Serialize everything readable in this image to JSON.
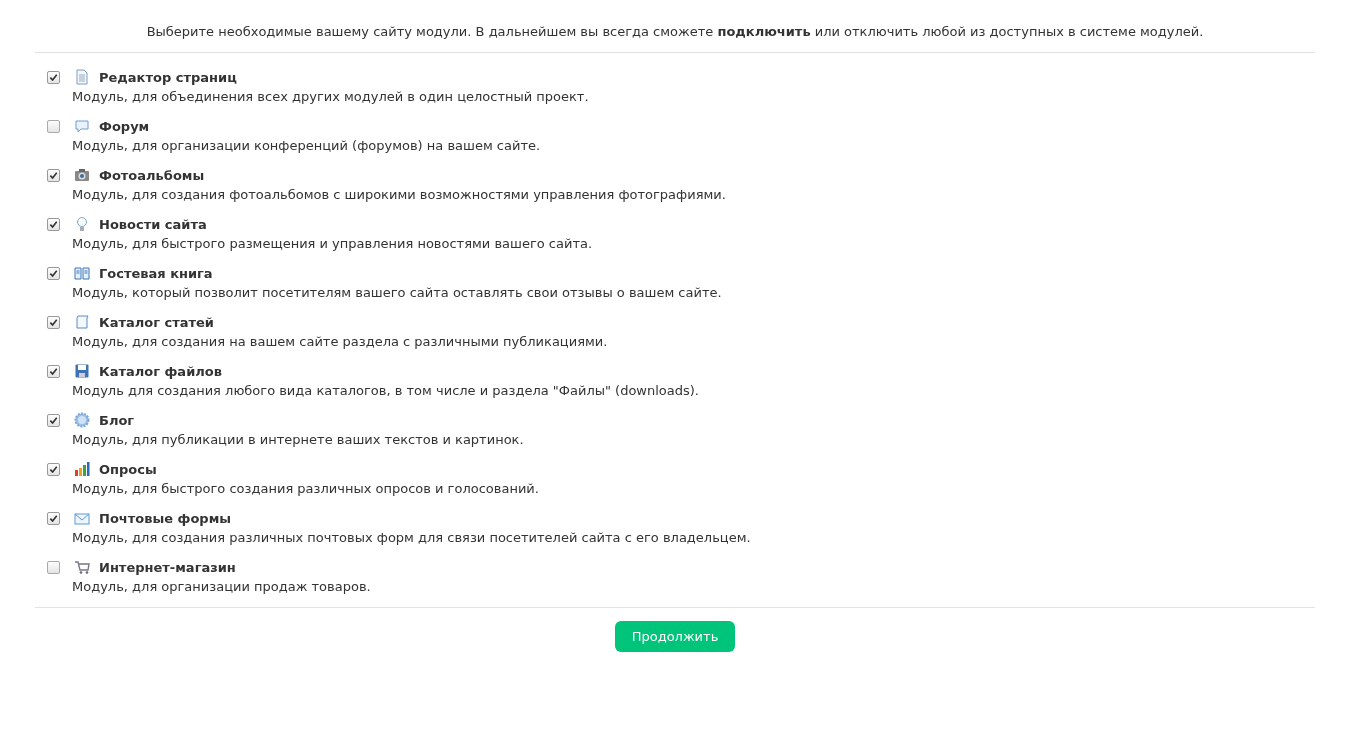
{
  "intro": "Выберите необходимые вашему сайту модули. В дальнейшем вы всегда сможете **подключить** или отключить любой из доступных в системе модулей.",
  "modules": [
    {
      "title": "Редактор страниц",
      "description": "Модуль, для объединения всех других модулей в один целостный проект.",
      "checked": true
    },
    {
      "title": "Форум",
      "description": "Модуль, для организации конференций (форумов) на вашем сайте.",
      "checked": false
    },
    {
      "title": "Фотоальбомы",
      "description": "Модуль, для создания фотоальбомов с широкими возможностями управления фотографиями.",
      "checked": true
    },
    {
      "title": "Новости сайта",
      "description": "Модуль, для быстрого размещения и управления новостями вашего сайта.",
      "checked": true
    },
    {
      "title": "Гостевая книга",
      "description": "Модуль, который позволит посетителям вашего сайта оставлять свои отзывы о вашем сайте.",
      "checked": true
    },
    {
      "title": "Каталог статей",
      "description": "Модуль, для создания на вашем сайте раздела с различными публикациями.",
      "checked": true
    },
    {
      "title": "Каталог файлов",
      "description": "Модуль для создания любого вида каталогов, в том числе и раздела \"Файлы\" (downloads).",
      "checked": true
    },
    {
      "title": "Блог",
      "description": "Модуль, для публикации в интернете ваших текстов и картинок.",
      "checked": true
    },
    {
      "title": "Опросы",
      "description": "Модуль, для быстрого создания различных опросов и голосований.",
      "checked": true
    },
    {
      "title": "Почтовые формы",
      "description": "Модуль, для создания различных почтовых форм для связи посетителей сайта с его владельцем.",
      "checked": true
    },
    {
      "title": "Интернет-магазин",
      "description": "Модуль, для организации продаж товаров.",
      "checked": false
    }
  ],
  "continue_button": "Продолжить"
}
